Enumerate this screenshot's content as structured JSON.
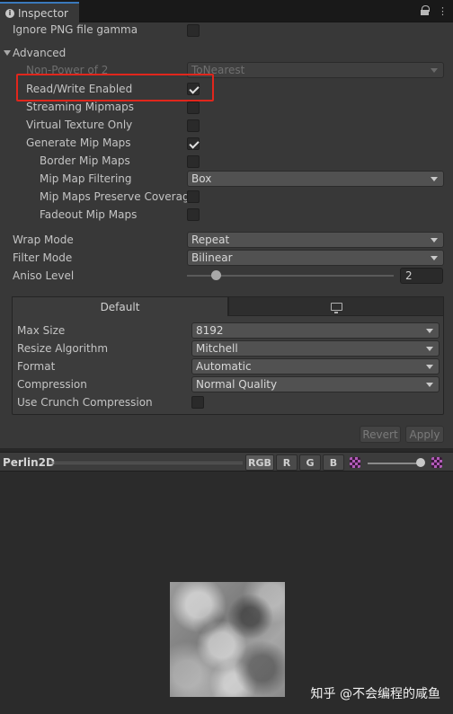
{
  "window": {
    "tab_title": "Inspector"
  },
  "rows": {
    "ignore_png_gamma": "Ignore PNG file gamma",
    "advanced": "Advanced",
    "non_power_of_2": "Non-Power of 2",
    "non_power_of_2_value": "ToNearest",
    "read_write": "Read/Write Enabled",
    "streaming_mipmaps": "Streaming Mipmaps",
    "virtual_texture": "Virtual Texture Only",
    "generate_mipmaps": "Generate Mip Maps",
    "border_mipmaps": "Border Mip Maps",
    "mipmap_filtering": "Mip Map Filtering",
    "mipmap_filtering_value": "Box",
    "mipmaps_preserve": "Mip Maps Preserve Coverage",
    "fadeout_mipmaps": "Fadeout Mip Maps",
    "wrap_mode": "Wrap Mode",
    "wrap_mode_value": "Repeat",
    "filter_mode": "Filter Mode",
    "filter_mode_value": "Bilinear",
    "aniso_level": "Aniso Level",
    "aniso_value": "2"
  },
  "checkboxes": {
    "ignore_png_gamma": false,
    "read_write": true,
    "streaming_mipmaps": false,
    "virtual_texture": false,
    "generate_mipmaps": true,
    "border_mipmaps": false,
    "mipmaps_preserve": false,
    "fadeout_mipmaps": false,
    "use_crunch": false
  },
  "platform": {
    "tab_default": "Default",
    "max_size": "Max Size",
    "max_size_value": "8192",
    "resize_algorithm": "Resize Algorithm",
    "resize_algorithm_value": "Mitchell",
    "format": "Format",
    "format_value": "Automatic",
    "compression": "Compression",
    "compression_value": "Normal Quality",
    "use_crunch": "Use Crunch Compression"
  },
  "buttons": {
    "revert": "Revert",
    "apply": "Apply"
  },
  "preview": {
    "title": "Perlin2D",
    "channels": [
      "RGB",
      "R",
      "G",
      "B"
    ]
  },
  "watermark": "知乎 @不会编程的咸鱼",
  "colors": {
    "highlight": "#e1261c",
    "accent": "#3a79bb"
  }
}
